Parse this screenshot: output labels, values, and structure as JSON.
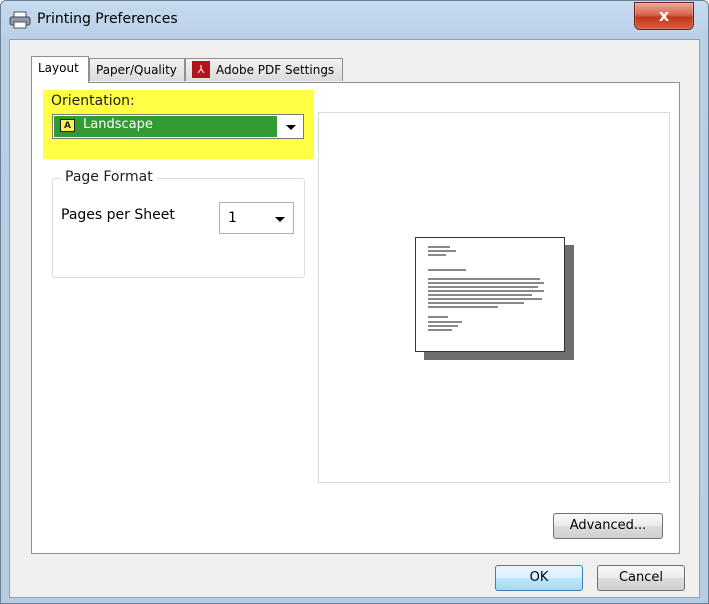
{
  "window": {
    "title": "Printing Preferences",
    "close_label": "x",
    "title_icon": "printer-icon"
  },
  "tabs": [
    {
      "label": "Layout",
      "active": true
    },
    {
      "label": "Paper/Quality",
      "active": false
    },
    {
      "label": "Adobe PDF Settings",
      "active": false,
      "icon": "adobe-pdf-icon"
    }
  ],
  "orientation": {
    "label": "Orientation:",
    "value": "Landscape",
    "value_icon": "landscape-icon",
    "icon_glyph": "A",
    "highlight_color": "#ffff44",
    "selected_bg": "#339b33"
  },
  "page_format": {
    "legend": "Page Format",
    "pages_per_sheet_label": "Pages per Sheet",
    "pages_per_sheet_value": "1"
  },
  "preview": {
    "icon": "page-preview-icon"
  },
  "buttons": {
    "advanced": "Advanced...",
    "ok": "OK",
    "cancel": "Cancel"
  }
}
